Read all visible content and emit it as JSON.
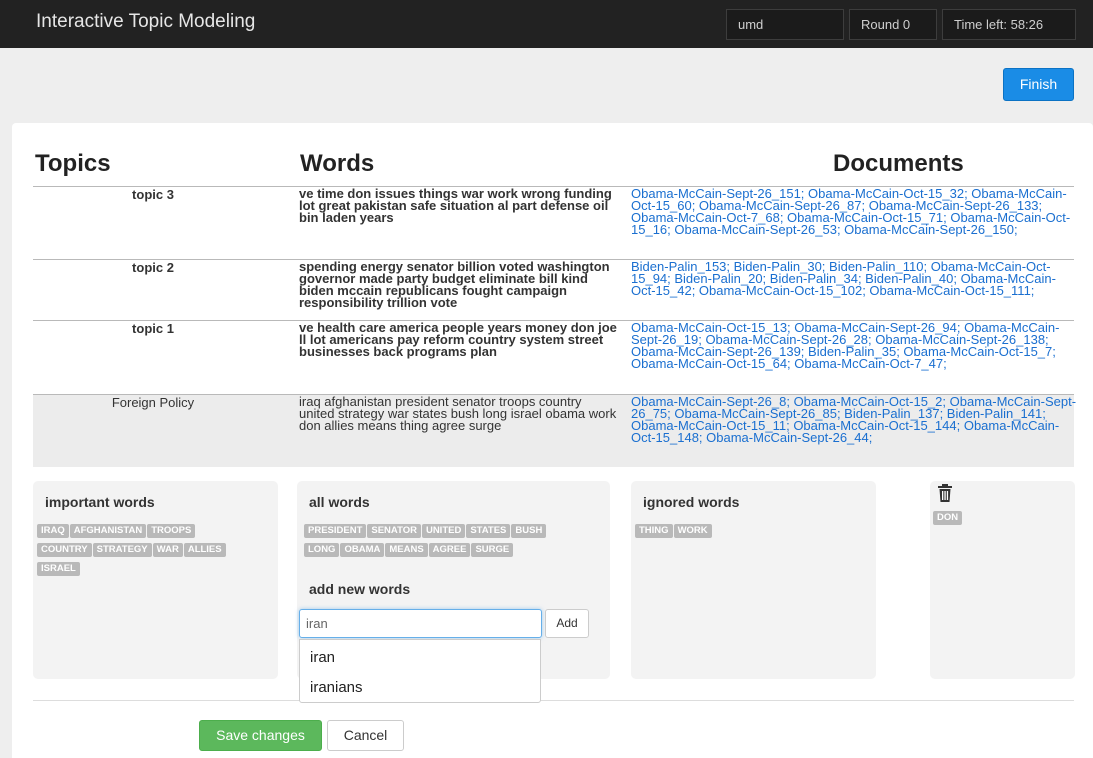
{
  "navbar": {
    "title": "Interactive Topic Modeling",
    "user": "umd",
    "round": "Round 0",
    "time_left": "Time left: 58:26"
  },
  "finish_label": "Finish",
  "headers": {
    "topics": "Topics",
    "words": "Words",
    "documents": "Documents"
  },
  "topics": [
    {
      "name": "topic 3",
      "words": "ve time don issues things war work wrong funding lot great pakistan safe situation al part defense oil bin laden years",
      "documents": "Obama-McCain-Sept-26_151; Obama-McCain-Oct-15_32; Obama-McCain-Oct-15_60; Obama-McCain-Sept-26_87; Obama-McCain-Sept-26_133; Obama-McCain-Oct-7_68; Obama-McCain-Oct-15_71; Obama-McCain-Oct-15_16; Obama-McCain-Sept-26_53; Obama-McCain-Sept-26_150;"
    },
    {
      "name": "topic 2",
      "words": "spending energy senator billion voted washington governor made party budget eliminate bill kind biden mccain republicans fought campaign responsibility trillion vote",
      "documents": "Biden-Palin_153; Biden-Palin_30; Biden-Palin_110; Obama-McCain-Oct-15_94; Biden-Palin_20; Biden-Palin_34; Biden-Palin_40; Obama-McCain-Oct-15_42; Obama-McCain-Oct-15_102; Obama-McCain-Oct-15_111;"
    },
    {
      "name": "topic 1",
      "words": "ve health care america people years money don joe ll lot americans pay reform country system street businesses back programs plan",
      "documents": "Obama-McCain-Oct-15_13; Obama-McCain-Sept-26_94; Obama-McCain-Sept-26_19; Obama-McCain-Sept-26_28; Obama-McCain-Sept-26_138; Obama-McCain-Sept-26_139; Biden-Palin_35; Obama-McCain-Oct-15_7; Obama-McCain-Oct-15_64; Obama-McCain-Oct-7_47;"
    },
    {
      "name": "Foreign Policy",
      "words": "iraq afghanistan president senator troops country united strategy war states bush long israel obama work don allies means thing agree surge",
      "documents": "Obama-McCain-Sept-26_8; Obama-McCain-Oct-15_2; Obama-McCain-Sept-26_75; Obama-McCain-Sept-26_85; Biden-Palin_137; Biden-Palin_141; Obama-McCain-Oct-15_11; Obama-McCain-Oct-15_144; Obama-McCain-Oct-15_148; Obama-McCain-Sept-26_44;"
    }
  ],
  "important": {
    "title": "important words",
    "tags": [
      "IRAQ",
      "AFGHANISTAN",
      "TROOPS",
      "COUNTRY",
      "STRATEGY",
      "WAR",
      "ALLIES",
      "ISRAEL"
    ]
  },
  "all_words": {
    "title": "all words",
    "tags": [
      "PRESIDENT",
      "SENATOR",
      "UNITED",
      "STATES",
      "BUSH",
      "LONG",
      "OBAMA",
      "MEANS",
      "AGREE",
      "SURGE"
    ],
    "add_title": "add new words",
    "input_value": "iran",
    "add_label": "Add",
    "suggestions": [
      "iran",
      "iranians"
    ]
  },
  "ignored": {
    "title": "ignored words",
    "tags": [
      "THING",
      "WORK"
    ]
  },
  "trash": {
    "icon": "trash-icon",
    "tags": [
      "DON"
    ]
  },
  "footer": {
    "save_label": "Save changes",
    "cancel_label": "Cancel"
  }
}
